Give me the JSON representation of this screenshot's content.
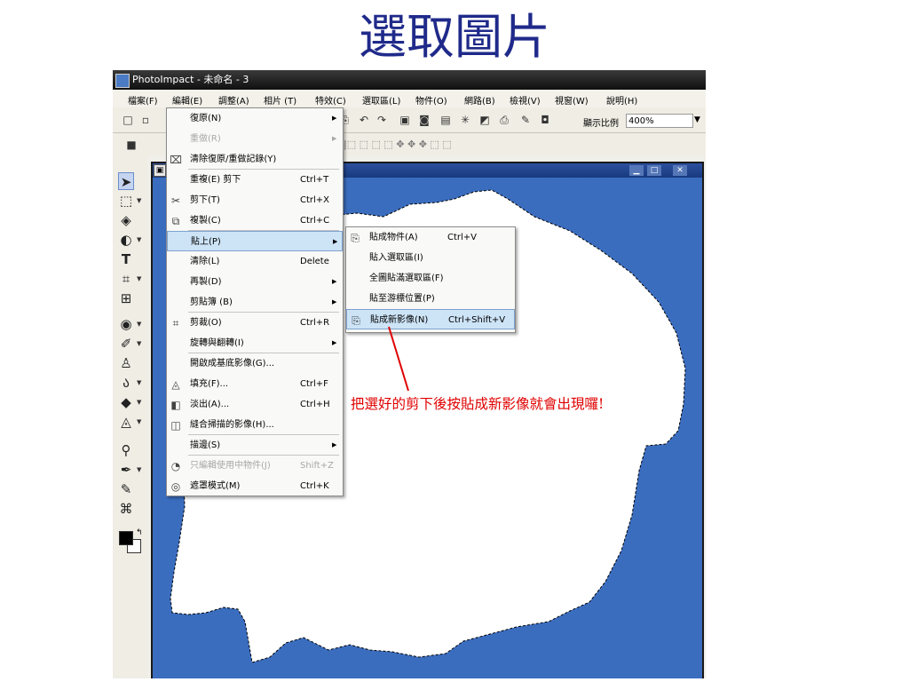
{
  "slide": {
    "title": "選取圖片"
  },
  "app": {
    "title": "PhotoImpact - 未命名 - 3"
  },
  "menubar": [
    {
      "label": "檔案(F)"
    },
    {
      "label": "編輯(E)"
    },
    {
      "label": "調整(A)"
    },
    {
      "label": "相片 (T)"
    },
    {
      "label": "特效(C)"
    },
    {
      "label": "選取區(L)"
    },
    {
      "label": "物件(O)"
    },
    {
      "label": "網路(B)"
    },
    {
      "label": "檢視(V)"
    },
    {
      "label": "視窗(W)"
    },
    {
      "label": "說明(H)"
    }
  ],
  "toolbar": {
    "zoom_label": "顯示比例",
    "zoom_value": "400%"
  },
  "edit_menu": {
    "items": [
      {
        "label": "復原(N)",
        "shortcut": "",
        "submenu": true,
        "disabled": false,
        "icon": ""
      },
      {
        "label": "重做(R)",
        "shortcut": "",
        "submenu": true,
        "disabled": true,
        "icon": ""
      },
      {
        "label": "清除復原/重做記錄(Y)",
        "shortcut": "",
        "submenu": false,
        "disabled": false,
        "icon": "clear-history-icon"
      },
      {
        "label": "重複(E) 剪下",
        "shortcut": "Ctrl+T",
        "submenu": false,
        "disabled": false,
        "icon": ""
      },
      {
        "label": "剪下(T)",
        "shortcut": "Ctrl+X",
        "submenu": false,
        "disabled": false,
        "icon": "scissors-icon"
      },
      {
        "label": "複製(C)",
        "shortcut": "Ctrl+C",
        "submenu": false,
        "disabled": false,
        "icon": "copy-icon"
      },
      {
        "label": "貼上(P)",
        "shortcut": "",
        "submenu": true,
        "disabled": false,
        "icon": "",
        "highlight": true
      },
      {
        "label": "清除(L)",
        "shortcut": "Delete",
        "submenu": false,
        "disabled": false,
        "icon": ""
      },
      {
        "label": "再製(D)",
        "shortcut": "",
        "submenu": true,
        "disabled": false,
        "icon": ""
      },
      {
        "label": "剪貼簿 (B)",
        "shortcut": "",
        "submenu": true,
        "disabled": false,
        "icon": ""
      },
      {
        "label": "剪裁(O)",
        "shortcut": "Ctrl+R",
        "submenu": false,
        "disabled": false,
        "icon": "crop-icon"
      },
      {
        "label": "旋轉與翻轉(I)",
        "shortcut": "",
        "submenu": true,
        "disabled": false,
        "icon": ""
      },
      {
        "label": "開啟成基底影像(G)...",
        "shortcut": "",
        "submenu": false,
        "disabled": false,
        "icon": ""
      },
      {
        "label": "填充(F)...",
        "shortcut": "Ctrl+F",
        "submenu": false,
        "disabled": false,
        "icon": "fill-icon"
      },
      {
        "label": "淡出(A)...",
        "shortcut": "Ctrl+H",
        "submenu": false,
        "disabled": false,
        "icon": "fade-icon"
      },
      {
        "label": "縫合掃描的影像(H)...",
        "shortcut": "",
        "submenu": false,
        "disabled": false,
        "icon": "stitch-icon"
      },
      {
        "label": "描邊(S)",
        "shortcut": "",
        "submenu": true,
        "disabled": false,
        "icon": ""
      },
      {
        "label": "只編輯使用中物件(J)",
        "shortcut": "Shift+Z",
        "submenu": false,
        "disabled": true,
        "icon": "edit-object-icon"
      },
      {
        "label": "遮罩模式(M)",
        "shortcut": "Ctrl+K",
        "submenu": false,
        "disabled": false,
        "icon": "mask-icon"
      }
    ]
  },
  "paste_submenu": {
    "items": [
      {
        "label": "貼成物件(A)",
        "shortcut": "Ctrl+V",
        "icon": "paste-object-icon"
      },
      {
        "label": "貼入選取區(I)",
        "shortcut": "",
        "icon": ""
      },
      {
        "label": "全圖貼滿選取區(F)",
        "shortcut": "",
        "icon": ""
      },
      {
        "label": "貼至游標位置(P)",
        "shortcut": "",
        "icon": ""
      },
      {
        "label": "貼成新影像(N)",
        "shortcut": "Ctrl+Shift+V",
        "icon": "new-image-icon",
        "highlight": true
      }
    ]
  },
  "callout": {
    "text": "把選好的剪下後按貼成新影像就會出現囉!"
  },
  "colors": {
    "accent": "#e00000",
    "title": "#1f2a8a",
    "canvas_blue": "#3b6dbf",
    "menu_highlight": "#cde4f7"
  }
}
